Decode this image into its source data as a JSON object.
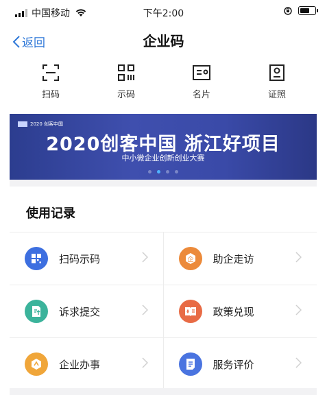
{
  "status_bar": {
    "carrier": "中国移动",
    "time": "下午2:00"
  },
  "nav": {
    "back_label": "返回",
    "title": "企业码"
  },
  "tools": [
    {
      "label": "扫码",
      "icon": "scan-icon"
    },
    {
      "label": "示码",
      "icon": "qrcode-icon"
    },
    {
      "label": "名片",
      "icon": "business-card-icon"
    },
    {
      "label": "证照",
      "icon": "license-icon"
    }
  ],
  "banner": {
    "tag": "2020 创客中国",
    "title": "2020创客中国 浙江好项目",
    "subtitle": "中小微企业创新创业大赛",
    "active_dot": 1,
    "dot_count": 4
  },
  "section": {
    "title": "使用记录"
  },
  "records": [
    {
      "label": "扫码示码",
      "icon": "qr-scan-icon",
      "color": "#3d6fe0"
    },
    {
      "label": "助企走访",
      "icon": "enterprise-icon",
      "color": "#ec8a3a"
    },
    {
      "label": "诉求提交",
      "icon": "document-upload-icon",
      "color": "#3bb39b"
    },
    {
      "label": "政策兑现",
      "icon": "policy-book-icon",
      "color": "#e86b45"
    },
    {
      "label": "企业办事",
      "icon": "affairs-icon",
      "color": "#f0a63a"
    },
    {
      "label": "服务评价",
      "icon": "rating-list-icon",
      "color": "#4a74e0"
    }
  ]
}
